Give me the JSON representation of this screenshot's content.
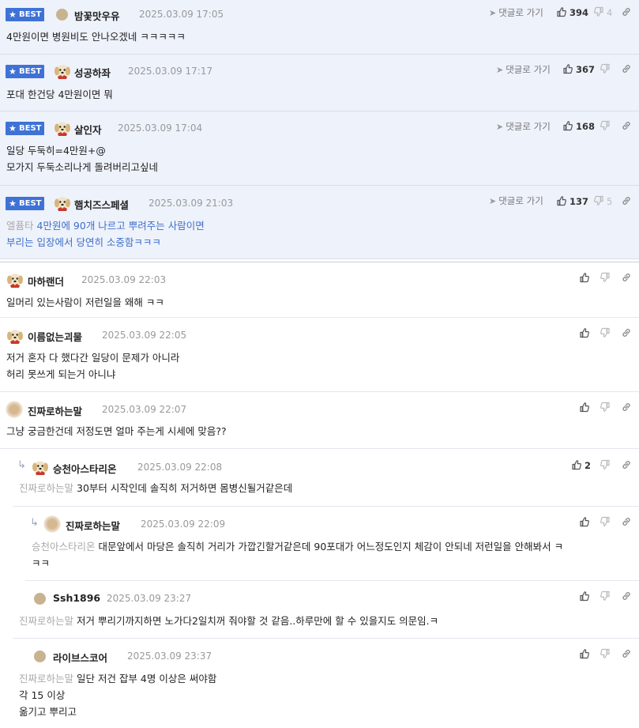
{
  "labels": {
    "best": "BEST",
    "go_comment": "댓글로 가기"
  },
  "best_comments": [
    {
      "nick": "밤꽃맛우유",
      "date": "2025.03.09 17:05",
      "text": "4만원이면 병원비도 안나오겠네 ㅋㅋㅋㅋㅋ",
      "likes": "394",
      "dislikes": "4"
    },
    {
      "nick": "성공하좌",
      "date": "2025.03.09 17:17",
      "text": "포대 한건당 4만원이면 뭐",
      "likes": "367",
      "dislikes": ""
    },
    {
      "nick": "살인자",
      "date": "2025.03.09 17:04",
      "text": "일당 두둑히=4만원+@\n모가지 두둑소리나게 돌려버리고싶네",
      "likes": "168",
      "dislikes": ""
    },
    {
      "nick": "햄치즈스페셜",
      "date": "2025.03.09 21:03",
      "mention": "엘퓸타",
      "text": "4만원에 90개 나르고 뿌려주는 사람이면\n부리는 입장에서 당연히 소중함ㅋㅋㅋ",
      "likes": "137",
      "dislikes": "5"
    }
  ],
  "comments": [
    {
      "nick": "마하랜더",
      "date": "2025.03.09 22:03",
      "text": "일머리 있는사람이 저런일을 왜해 ㅋㅋ",
      "likes": ""
    },
    {
      "nick": "이름없는괴물",
      "date": "2025.03.09 22:05",
      "text": "저거 혼자 다 했다간 일당이 문제가 아니라\n허리 못쓰게 되는거 아니냐",
      "likes": ""
    },
    {
      "nick": "진짜로하는말",
      "date": "2025.03.09 22:07",
      "text": "그냥 궁금한건데 저정도면 얼마 주는게 시세에 맞음??",
      "likes": ""
    },
    {
      "nick": "승천아스타리온",
      "date": "2025.03.09 22:08",
      "mention": "진짜로하는말",
      "text": "30부터 시작인데 솔직히 저거하면 몸병신될거같은데",
      "likes": "2"
    },
    {
      "nick": "진짜로하는말",
      "date": "2025.03.09 22:09",
      "mention": "승천아스타리온",
      "text": "대문앞에서 마당은 솔직히 거리가 가깝긴할거같은데 90포대가 어느정도인지 체감이 안되네 저런일을 안해봐서 ㅋ\nㅋㅋ",
      "likes": ""
    },
    {
      "nick": "Ssh1896",
      "date": "2025.03.09 23:27",
      "mention": "진짜로하는말",
      "text": "저거 뿌리기까지하면 노가다2일치꺼 줘야할 것 같음..하루만에 할 수 있을지도 의문임.ㅋ",
      "likes": ""
    },
    {
      "nick": "라이브스코어",
      "date": "2025.03.09 23:37",
      "mention": "진짜로하는말",
      "text": "일단 저건 잡부 4명 이상은 써야함\n각 15 이상\n옮기고 뿌리고",
      "likes": ""
    }
  ],
  "colors": {
    "best_bg": "#eef2fb",
    "badge": "#3f72d6",
    "mention": "#aaaaaa",
    "highlight_text": "#3f6fc9"
  },
  "icons": [
    "star-icon",
    "thumbs-up-icon",
    "thumbs-down-icon",
    "link-icon",
    "reply-arrow-icon",
    "send-arrow-icon"
  ]
}
